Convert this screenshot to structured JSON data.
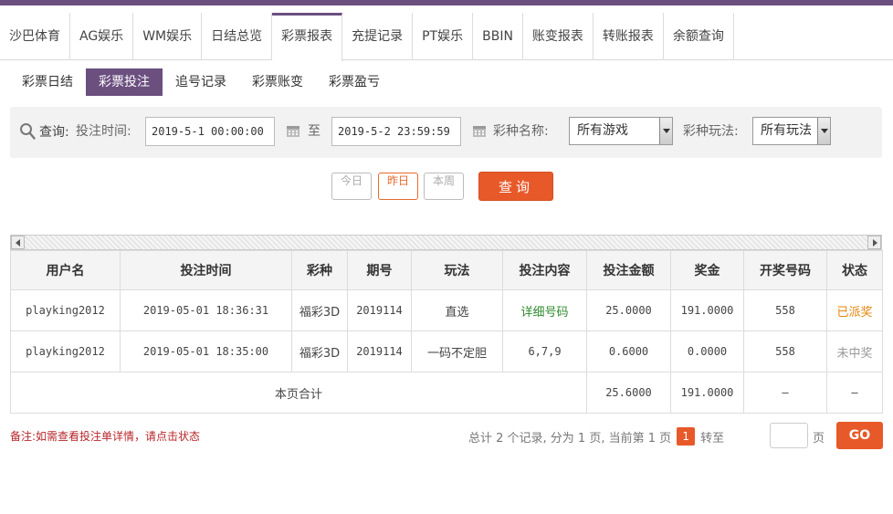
{
  "nav": {
    "items": [
      "沙巴体育",
      "AG娱乐",
      "WM娱乐",
      "日结总览",
      "彩票报表",
      "充提记录",
      "PT娱乐",
      "BBIN",
      "账变报表",
      "转账报表",
      "余额查询"
    ],
    "active_index": 4
  },
  "subtabs": {
    "items": [
      "彩票日结",
      "彩票投注",
      "追号记录",
      "彩票账变",
      "彩票盈亏"
    ],
    "active_index": 1
  },
  "search": {
    "label": "查询:",
    "time_label": "投注时间:",
    "start_time": "2019-5-1 00:00:00",
    "to_label": "至",
    "end_time": "2019-5-2 23:59:59",
    "game_label": "彩种名称:",
    "game_value": "所有游戏",
    "play_label": "彩种玩法:",
    "play_value": "所有玩法"
  },
  "quick": {
    "today": "今日",
    "yesterday": "昨日",
    "week": "本周",
    "active": "yesterday"
  },
  "query_button": "查询",
  "table": {
    "headers": [
      "用户名",
      "投注时间",
      "彩种",
      "期号",
      "玩法",
      "投注内容",
      "投注金额",
      "奖金",
      "开奖号码",
      "状态"
    ],
    "rows": [
      {
        "user": "playking2012",
        "time": "2019-05-01 18:36:31",
        "lottery": "福彩3D",
        "issue": "2019114",
        "play": "直选",
        "content": "详细号码",
        "amount": "25.0000",
        "prize": "191.0000",
        "draw": "558",
        "status": "已派奖"
      },
      {
        "user": "playking2012",
        "time": "2019-05-01 18:35:00",
        "lottery": "福彩3D",
        "issue": "2019114",
        "play": "一码不定胆",
        "content": "6,7,9",
        "amount": "0.6000",
        "prize": "0.0000",
        "draw": "558",
        "status": "未中奖"
      }
    ],
    "total": {
      "label": "本页合计",
      "amount": "25.6000",
      "prize": "191.0000",
      "draw": "—",
      "status": "—"
    }
  },
  "note": "备注:如需查看投注单详情，请点击状态",
  "pager": {
    "text_before": "总计 2 个记录, 分为 1 页, 当前第 1 页",
    "current_page": "1",
    "goto_label": "转至",
    "unit": "页",
    "go": "GO"
  },
  "colors": {
    "accent": "#6b4f7f",
    "button": "#e8592a",
    "won": "#e6840c",
    "link": "#2e8b2e",
    "note": "#b8262a"
  }
}
